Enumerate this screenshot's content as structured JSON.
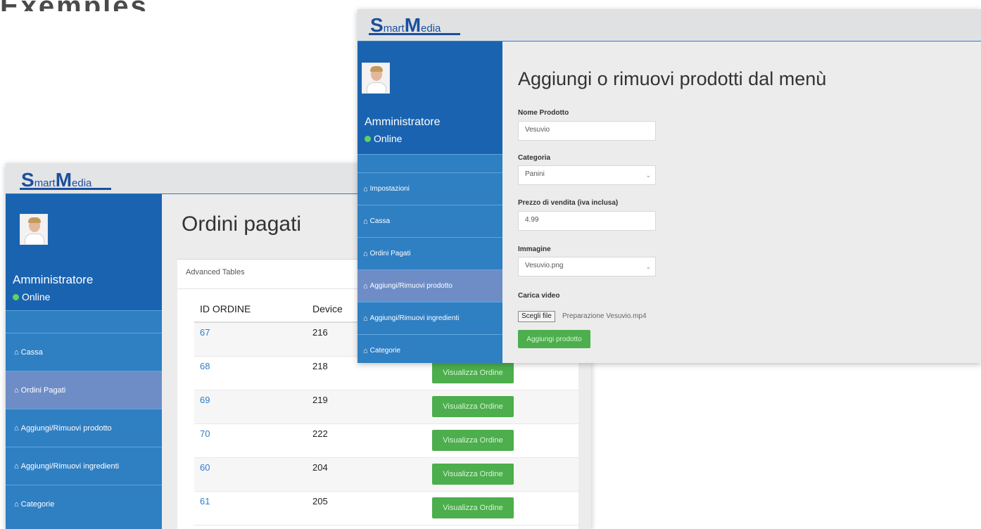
{
  "top_strip_text": "Exemples d'applications",
  "logo": {
    "text_big": "S",
    "text_mid": "mart",
    "text_big2": "M",
    "text_end": "edia"
  },
  "ordini_window": {
    "admin_name": "Amministratore",
    "status": "Online",
    "menu": [
      "Cassa",
      "Ordini Pagati",
      "Aggiungi/Rimuovi prodotto",
      "Aggiungi/Rimuovi ingredienti",
      "Categorie"
    ],
    "active_menu_index": 1,
    "page_title": "Ordini pagati",
    "card_title": "Advanced Tables",
    "columns": [
      "ID ORDINE",
      "Device"
    ],
    "rows": [
      {
        "id": "67",
        "device": "216",
        "button": ""
      },
      {
        "id": "68",
        "device": "218",
        "button": "Visualizza Ordine"
      },
      {
        "id": "69",
        "device": "219",
        "button": "Visualizza Ordine"
      },
      {
        "id": "70",
        "device": "222",
        "button": "Visualizza Ordine"
      },
      {
        "id": "60",
        "device": "204",
        "button": "Visualizza Ordine"
      },
      {
        "id": "61",
        "device": "205",
        "button": "Visualizza Ordine"
      }
    ]
  },
  "prodotti_window": {
    "admin_name": "Amministratore",
    "status": "Online",
    "menu": [
      "Impostazioni",
      "Cassa",
      "Ordini Pagati",
      "Aggiungi/Rimuovi prodotto",
      "Aggiungi/Rimuovi ingredienti",
      "Categorie"
    ],
    "active_menu_index": 3,
    "page_title": "Aggiungi o rimuovi prodotti dal menù",
    "fields": {
      "nome_label": "Nome Prodotto",
      "nome_value": "Vesuvio",
      "categoria_label": "Categoria",
      "categoria_value": "Panini",
      "prezzo_label": "Prezzo di vendita (iva inclusa)",
      "prezzo_value": "4.99",
      "immagine_label": "Immagine",
      "immagine_value": "Vesuvio.png",
      "video_label": "Carica video",
      "file_button": "Scegli file",
      "file_name": "Preparazione Vesuvio.mp4"
    },
    "submit": "Aggiungi prodotto"
  }
}
